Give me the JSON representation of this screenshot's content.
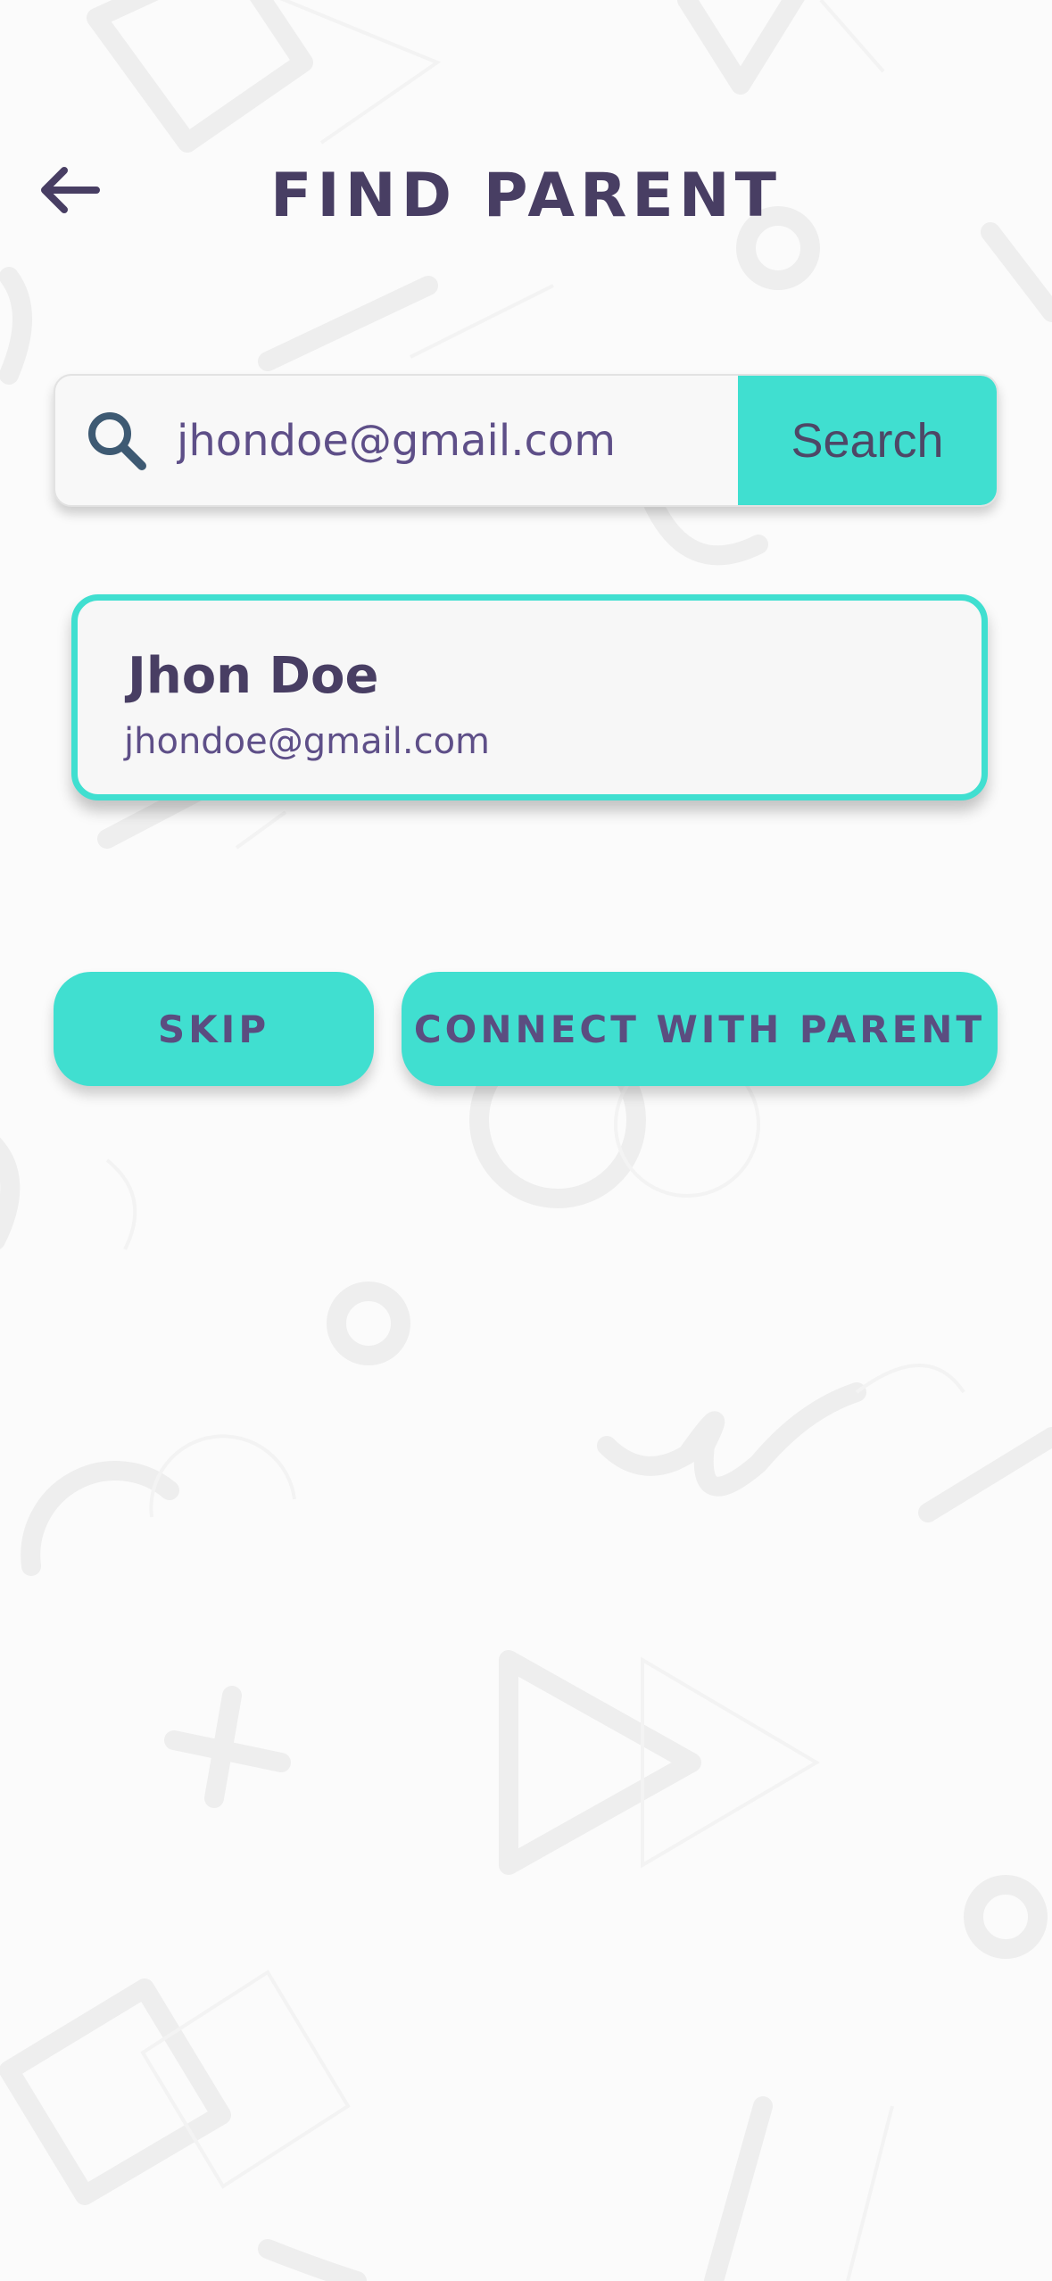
{
  "header": {
    "title": "FIND PARENT",
    "back_icon": "arrow-left-icon"
  },
  "search": {
    "icon": "search-icon",
    "value": "jhondoe@gmail.com",
    "button_label": "Search"
  },
  "result": {
    "name": "Jhon Doe",
    "email": "jhondoe@gmail.com"
  },
  "actions": {
    "skip_label": "SKIP",
    "connect_label": "CONNECT WITH PARENT"
  },
  "colors": {
    "accent": "#40dfd0",
    "primary_text": "#483e63",
    "secondary_text": "#5e4f88",
    "background": "#fbfbfb"
  }
}
